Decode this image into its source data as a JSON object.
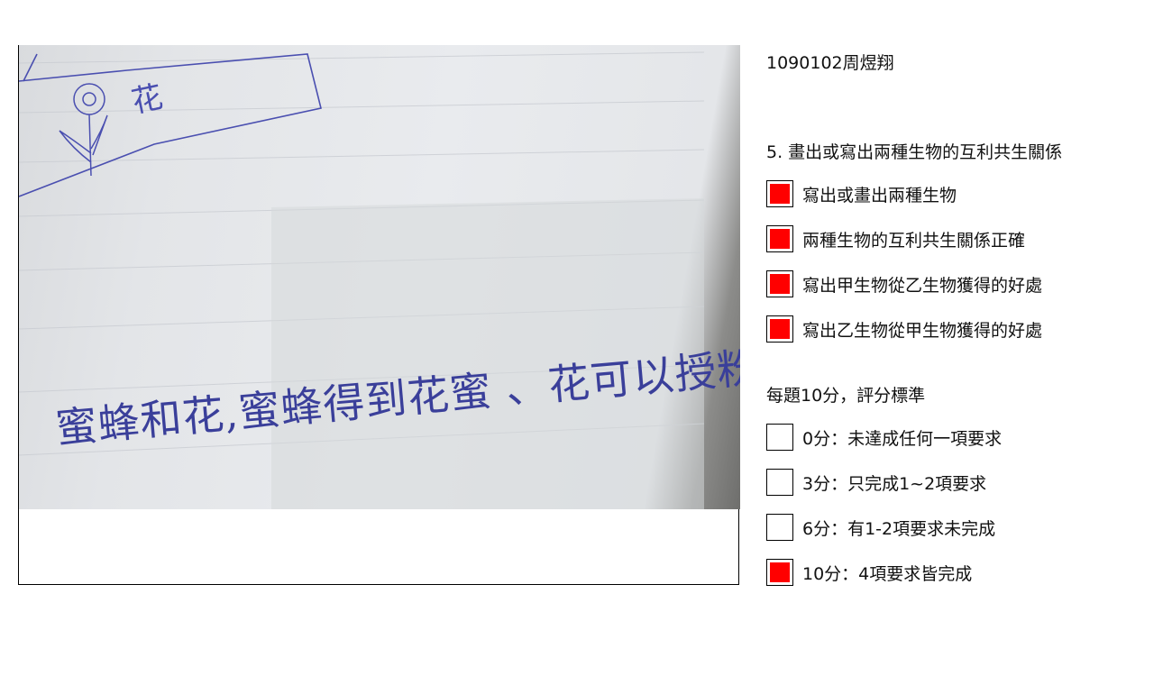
{
  "student": {
    "name": "1090102周煜翔"
  },
  "question": {
    "title": "5. 畫出或寫出兩種生物的互利共生關係"
  },
  "criteria": [
    {
      "label": "寫出或畫出兩種生物",
      "checked": true
    },
    {
      "label": "兩種生物的互利共生關係正確",
      "checked": true
    },
    {
      "label": "寫出甲生物從乙生物獲得的好處",
      "checked": true
    },
    {
      "label": "寫出乙生物從甲生物獲得的好處",
      "checked": true
    }
  ],
  "scoring": {
    "title": "每題10分，評分標準",
    "options": [
      {
        "label": "0分：未達成任何一項要求",
        "checked": false
      },
      {
        "label": "3分：只完成1~2項要求",
        "checked": false
      },
      {
        "label": "6分：有1-2項要求未完成",
        "checked": false
      },
      {
        "label": "10分：4項要求皆完成",
        "checked": true
      }
    ]
  },
  "photo": {
    "drawing_label": "花",
    "handwriting": "蜜蜂和花,蜜蜂得到花蜜 、花可以授粉"
  },
  "colors": {
    "checked_fill": "#ff0000",
    "ink": "#3a3f9a"
  }
}
